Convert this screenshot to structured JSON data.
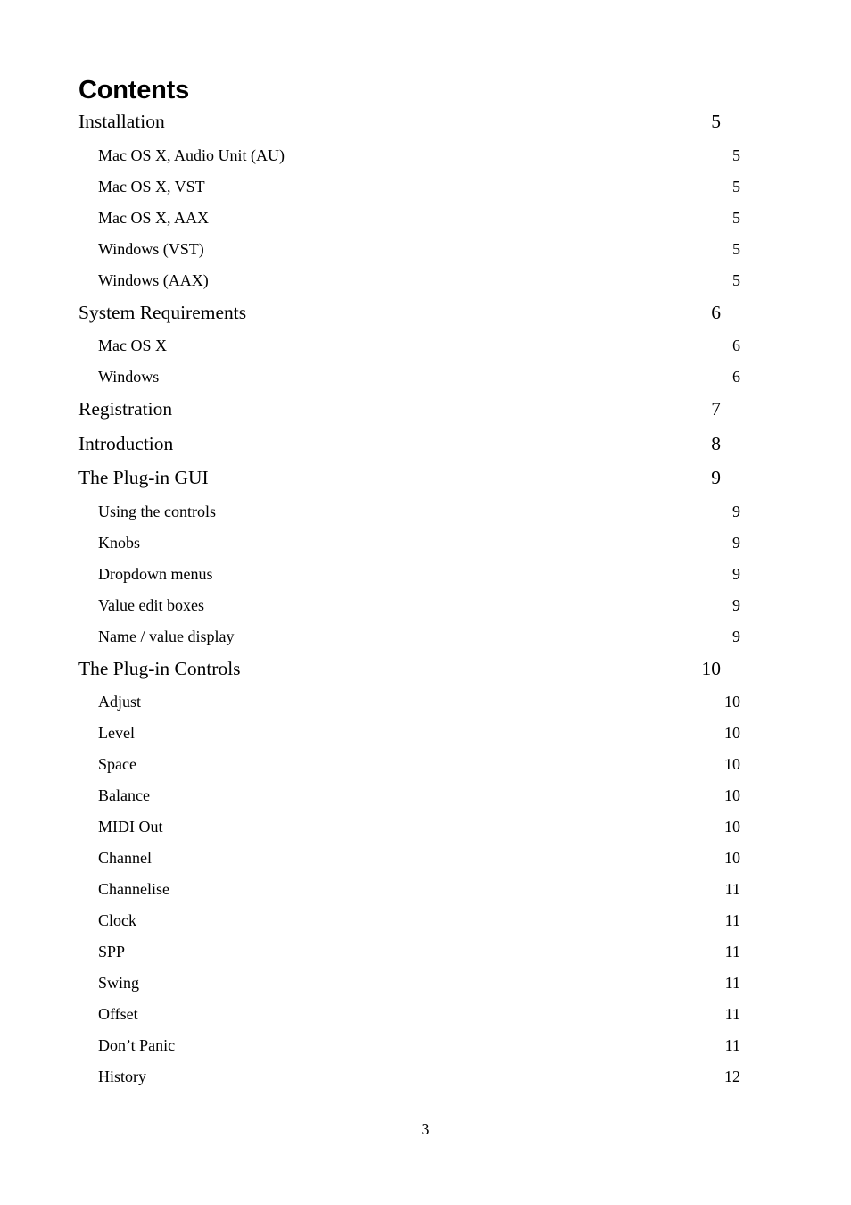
{
  "document": {
    "heading": "Contents",
    "footer_page_number": "3"
  },
  "toc": {
    "entries": [
      {
        "label": "Installation",
        "page": "5",
        "level": 1
      },
      {
        "label": "Mac OS X, Audio Unit (AU)",
        "page": "5",
        "level": 2
      },
      {
        "label": "Mac OS X, VST",
        "page": "5",
        "level": 2
      },
      {
        "label": "Mac OS X, AAX",
        "page": "5",
        "level": 2
      },
      {
        "label": "Windows (VST)",
        "page": "5",
        "level": 2
      },
      {
        "label": "Windows (AAX)",
        "page": "5",
        "level": 2
      },
      {
        "label": "System Requirements",
        "page": "6",
        "level": 1
      },
      {
        "label": "Mac OS X",
        "page": "6",
        "level": 2
      },
      {
        "label": "Windows",
        "page": "6",
        "level": 2
      },
      {
        "label": "Registration",
        "page": "7",
        "level": 1
      },
      {
        "label": "Introduction",
        "page": "8",
        "level": 1
      },
      {
        "label": "The Plug-in GUI",
        "page": "9",
        "level": 1
      },
      {
        "label": "Using the controls",
        "page": "9",
        "level": 2
      },
      {
        "label": "Knobs",
        "page": "9",
        "level": 2
      },
      {
        "label": "Dropdown menus",
        "page": "9",
        "level": 2
      },
      {
        "label": "Value edit boxes",
        "page": "9",
        "level": 2
      },
      {
        "label": "Name / value display",
        "page": "9",
        "level": 2
      },
      {
        "label": "The Plug-in Controls",
        "page": "10",
        "level": 1
      },
      {
        "label": "Adjust",
        "page": "10",
        "level": 2
      },
      {
        "label": "Level",
        "page": "10",
        "level": 2
      },
      {
        "label": "Space",
        "page": "10",
        "level": 2
      },
      {
        "label": "Balance",
        "page": "10",
        "level": 2
      },
      {
        "label": "MIDI Out",
        "page": "10",
        "level": 2
      },
      {
        "label": "Channel",
        "page": "10",
        "level": 2
      },
      {
        "label": "Channelise",
        "page": "11",
        "level": 2
      },
      {
        "label": "Clock",
        "page": "11",
        "level": 2
      },
      {
        "label": "SPP",
        "page": "11",
        "level": 2
      },
      {
        "label": "Swing",
        "page": "11",
        "level": 2
      },
      {
        "label": "Offset",
        "page": "11",
        "level": 2
      },
      {
        "label": "Don’t Panic",
        "page": "11",
        "level": 2
      },
      {
        "label": "History",
        "page": "12",
        "level": 2
      }
    ]
  }
}
